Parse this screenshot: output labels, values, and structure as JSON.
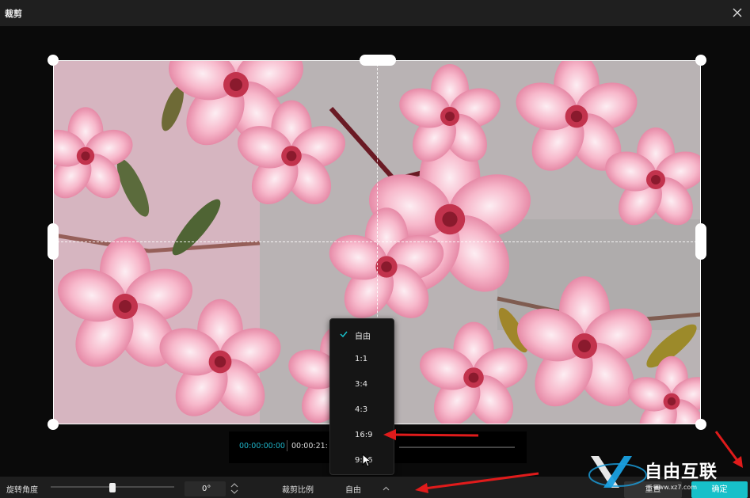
{
  "window": {
    "title": "裁剪"
  },
  "timeline": {
    "current": "00:00:00:00",
    "total": "00:00:21:"
  },
  "controls": {
    "rotation_label": "旋转角度",
    "rotation_value": "0°",
    "ratio_label": "裁剪比例",
    "ratio_value": "自由",
    "reset_label": "重置",
    "confirm_label": "确定"
  },
  "ratio_menu": {
    "options": [
      "自由",
      "1:1",
      "3:4",
      "4:3",
      "16:9",
      "9:16"
    ],
    "selected": "自由"
  },
  "watermark": {
    "text": "自由互联",
    "url": "www.xz7.com"
  },
  "colors": {
    "accent": "#17c0c9",
    "arrow": "#e01b1b"
  }
}
